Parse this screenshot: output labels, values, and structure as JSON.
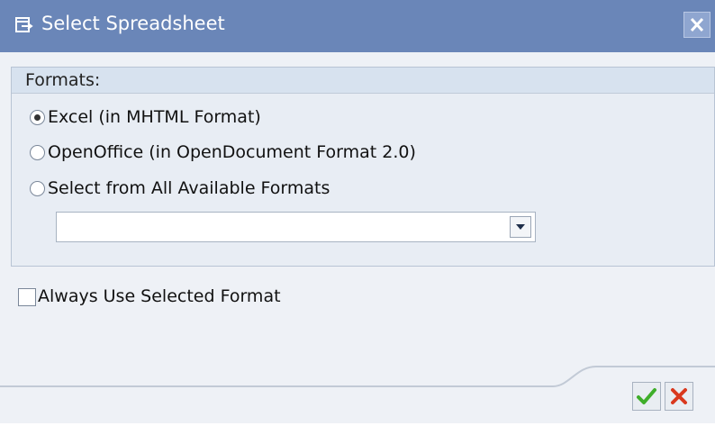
{
  "window": {
    "title": "Select Spreadsheet",
    "title_icon": "window-export-icon",
    "close_icon": "close-icon"
  },
  "formats": {
    "label": "Formats:",
    "options": [
      {
        "label": "Excel (in MHTML Format)",
        "selected": true
      },
      {
        "label": "OpenOffice (in OpenDocument Format 2.0)",
        "selected": false
      },
      {
        "label": "Select from All Available Formats",
        "selected": false
      }
    ],
    "dropdown": {
      "value": "",
      "arrow_icon": "chevron-down-icon"
    }
  },
  "always_use": {
    "label": "Always Use Selected Format",
    "checked": false
  },
  "actions": {
    "confirm_icon": "checkmark-icon",
    "cancel_icon": "cancel-icon"
  },
  "colors": {
    "titlebar": "#6a86b8",
    "confirm_green": "#3fae2a",
    "cancel_red": "#d9381e"
  }
}
